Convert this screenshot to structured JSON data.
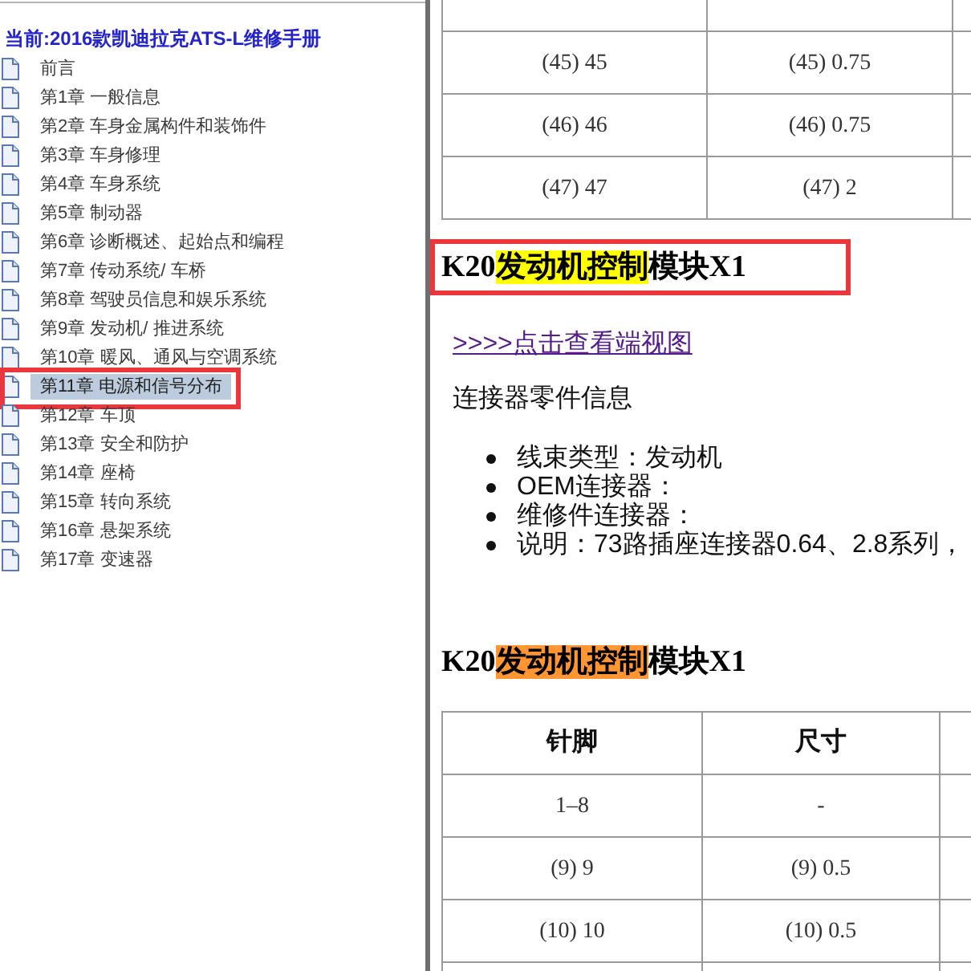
{
  "sidebar": {
    "title": "当前:2016款凯迪拉克ATS-L维修手册",
    "items": [
      {
        "label": "前言",
        "selected": false,
        "annotated": false
      },
      {
        "label": "第1章 一般信息",
        "selected": false,
        "annotated": false
      },
      {
        "label": "第2章 车身金属构件和装饰件",
        "selected": false,
        "annotated": false
      },
      {
        "label": "第3章 车身修理",
        "selected": false,
        "annotated": false
      },
      {
        "label": "第4章 车身系统",
        "selected": false,
        "annotated": false
      },
      {
        "label": "第5章 制动器",
        "selected": false,
        "annotated": false
      },
      {
        "label": "第6章 诊断概述、起始点和编程",
        "selected": false,
        "annotated": false
      },
      {
        "label": "第7章 传动系统/ 车桥",
        "selected": false,
        "annotated": false
      },
      {
        "label": "第8章 驾驶员信息和娱乐系统",
        "selected": false,
        "annotated": false
      },
      {
        "label": "第9章 发动机/ 推进系统",
        "selected": false,
        "annotated": false
      },
      {
        "label": "第10章 暖风、通风与空调系统",
        "selected": false,
        "annotated": false
      },
      {
        "label": "第11章 电源和信号分布",
        "selected": true,
        "annotated": true
      },
      {
        "label": "第12章 车顶",
        "selected": false,
        "annotated": false
      },
      {
        "label": "第13章 安全和防护",
        "selected": false,
        "annotated": false
      },
      {
        "label": "第14章 座椅",
        "selected": false,
        "annotated": false
      },
      {
        "label": "第15章 转向系统",
        "selected": false,
        "annotated": false
      },
      {
        "label": "第16章 悬架系统",
        "selected": false,
        "annotated": false
      },
      {
        "label": "第17章 变速器",
        "selected": false,
        "annotated": false
      }
    ]
  },
  "content": [
    {
      "kind": "table",
      "continued": true,
      "continues": false,
      "rows": [
        [
          "(45) 45",
          "(45) 0.75"
        ],
        [
          "(46) 46",
          "(46) 0.75"
        ],
        [
          "(47) 47",
          "(47) 2"
        ]
      ]
    },
    {
      "kind": "heading",
      "annotated": true,
      "current_match": false,
      "parts": [
        {
          "text": "K20",
          "highlighted": false
        },
        {
          "text": "发动机控制",
          "highlighted": true
        },
        {
          "text": "模块X1",
          "highlighted": false
        }
      ]
    },
    {
      "kind": "link",
      "text": ">>>>点击查看端视图"
    },
    {
      "kind": "paragraph",
      "text": "连接器零件信息"
    },
    {
      "kind": "bullet_list",
      "items": [
        "线束类型：发动机",
        "OEM连接器：",
        "维修件连接器：",
        "说明：73路插座连接器0.64、2.8系列，"
      ]
    },
    {
      "kind": "heading",
      "annotated": false,
      "current_match": true,
      "parts": [
        {
          "text": "K20",
          "highlighted": false
        },
        {
          "text": "发动机控制",
          "highlighted": true
        },
        {
          "text": "模块X1",
          "highlighted": false
        }
      ]
    },
    {
      "kind": "table",
      "continued": false,
      "continues": true,
      "columns": [
        "针脚",
        "尺寸"
      ],
      "rows": [
        [
          "1–8",
          "-"
        ],
        [
          "(9) 9",
          "(9) 0.5"
        ],
        [
          "(10) 10",
          "(10) 0.5"
        ]
      ]
    }
  ]
}
